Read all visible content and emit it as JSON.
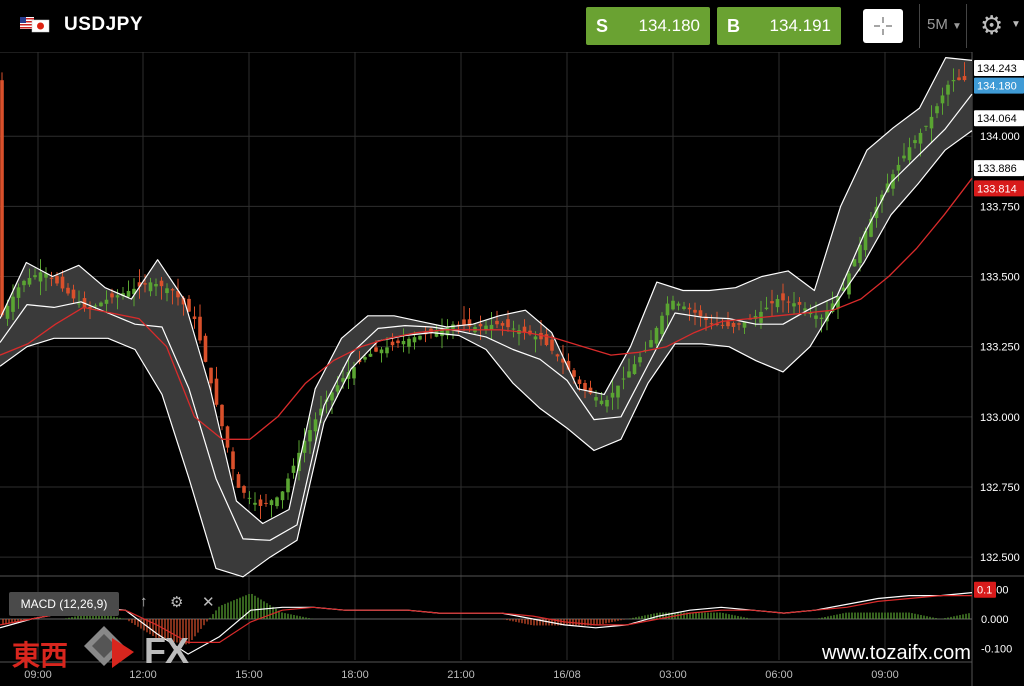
{
  "header": {
    "symbol": "USDJPY",
    "flag_icon": "us-jp-flag-icon",
    "sell": {
      "label": "S",
      "price": "134.180"
    },
    "buy": {
      "label": "B",
      "price": "134.191"
    },
    "timeframe": "5M"
  },
  "price_axis": {
    "ticks": [
      "134.000",
      "133.750",
      "133.500",
      "133.250",
      "133.000",
      "132.750",
      "132.500"
    ],
    "tick_values": [
      134.0,
      133.75,
      133.5,
      133.25,
      133.0,
      132.75,
      132.5
    ],
    "tags": [
      {
        "text": "134.243",
        "value": 134.243,
        "bg": "#ffffff",
        "fg": "#000000"
      },
      {
        "text": "134.180",
        "value": 134.18,
        "bg": "#3f9bd6",
        "fg": "#ffffff"
      },
      {
        "text": "134.064",
        "value": 134.064,
        "bg": "#ffffff",
        "fg": "#000000"
      },
      {
        "text": "133.886",
        "value": 133.886,
        "bg": "#ffffff",
        "fg": "#000000"
      },
      {
        "text": "133.814",
        "value": 133.814,
        "bg": "#d81b1b",
        "fg": "#ffffff"
      }
    ]
  },
  "time_axis": {
    "labels": [
      "09:00",
      "12:00",
      "15:00",
      "18:00",
      "21:00",
      "16/08",
      "03:00",
      "06:00",
      "09:00"
    ]
  },
  "macd": {
    "label": "MACD (12,26,9)",
    "ticks": [
      "0.100",
      "0.000",
      "-0.100"
    ],
    "tick_values": [
      0.1,
      0.0,
      -0.1
    ],
    "tag": {
      "text": "0.1",
      "value": 0.1,
      "bg": "#d81b1b"
    }
  },
  "chart_data": {
    "type": "line",
    "ylim": [
      132.44,
      134.3
    ],
    "series": [
      {
        "values": [
          133.35,
          133.48,
          133.52,
          133.45,
          133.38,
          133.42,
          133.45,
          133.48,
          133.45,
          133.35,
          133.05,
          132.75,
          132.68,
          132.72,
          132.9,
          133.05,
          133.15,
          133.22,
          133.25,
          133.28,
          133.3,
          133.33,
          133.32,
          133.33,
          133.31,
          133.28,
          133.2,
          133.1,
          133.05,
          133.15,
          133.25,
          133.42,
          133.38,
          133.33,
          133.32,
          133.36,
          133.42,
          133.4,
          133.35,
          133.45,
          133.65,
          133.82,
          133.95,
          134.05,
          134.2,
          134.2
        ]
      },
      {
        "values": [
          133.22,
          133.26,
          133.33,
          133.39,
          133.37,
          133.35,
          133.25,
          133.0,
          132.92,
          132.92,
          133.0,
          133.12,
          133.2,
          133.25,
          133.28,
          133.3,
          133.31,
          133.31,
          133.31,
          133.3,
          133.28,
          133.25,
          133.22,
          133.23,
          133.25,
          133.3,
          133.34,
          133.35,
          133.36,
          133.37,
          133.38,
          133.42,
          133.5,
          133.6,
          133.72,
          133.85
        ]
      },
      {
        "values": [
          133.35,
          133.55,
          133.5,
          133.54,
          133.46,
          133.42,
          133.56,
          133.42,
          133.1,
          132.7,
          132.62,
          132.67,
          133.1,
          133.28,
          133.36,
          133.36,
          133.34,
          133.32,
          133.33,
          133.36,
          133.38,
          133.3,
          133.1,
          133.08,
          133.25,
          133.48,
          133.45,
          133.45,
          133.46,
          133.5,
          133.52,
          133.45,
          133.75,
          133.95,
          134.03,
          134.1,
          134.28,
          134.27
        ]
      },
      {
        "values": [
          133.18,
          133.25,
          133.28,
          133.28,
          133.28,
          133.24,
          133.08,
          132.78,
          132.46,
          132.43,
          132.5,
          132.56,
          132.98,
          133.17,
          133.27,
          133.29,
          133.3,
          133.29,
          133.24,
          133.12,
          133.03,
          132.96,
          132.88,
          132.92,
          133.12,
          133.26,
          133.26,
          133.25,
          133.2,
          133.16,
          133.25,
          133.41,
          133.55,
          133.72,
          133.83,
          133.95,
          134.02
        ]
      }
    ],
    "macd_values": [
      -0.03,
      0.0,
      0.02,
      0.04,
      0.03,
      -0.05,
      -0.12,
      -0.06,
      0.03,
      0.04,
      0.04,
      0.03,
      0.03,
      0.03,
      0.02,
      0.02,
      0.02,
      0.0,
      -0.02,
      -0.03,
      -0.02,
      0.01,
      0.03,
      0.04,
      0.03,
      0.02,
      0.03,
      0.05,
      0.07,
      0.08,
      0.08,
      0.09
    ],
    "signal_values": [
      -0.02,
      0.0,
      0.02,
      0.03,
      0.03,
      -0.02,
      -0.08,
      -0.08,
      -0.01,
      0.03,
      0.04,
      0.03,
      0.03,
      0.03,
      0.02,
      0.02,
      0.02,
      0.01,
      -0.01,
      -0.02,
      -0.02,
      0.0,
      0.02,
      0.03,
      0.03,
      0.02,
      0.03,
      0.04,
      0.06,
      0.07,
      0.08,
      0.08
    ],
    "macd_ylim": [
      -0.14,
      0.14
    ]
  },
  "watermark": {
    "kanji": "東西",
    "fx": "FX",
    "site": "www.tozaifx.com"
  },
  "colors": {
    "bollinger_fill": "#3a3a3a",
    "band_line": "#ffffff",
    "ma_line": "#d92b2b",
    "up_candle": "#5aa532",
    "down_candle": "#d9502b",
    "grid": "#2e2e2e"
  }
}
